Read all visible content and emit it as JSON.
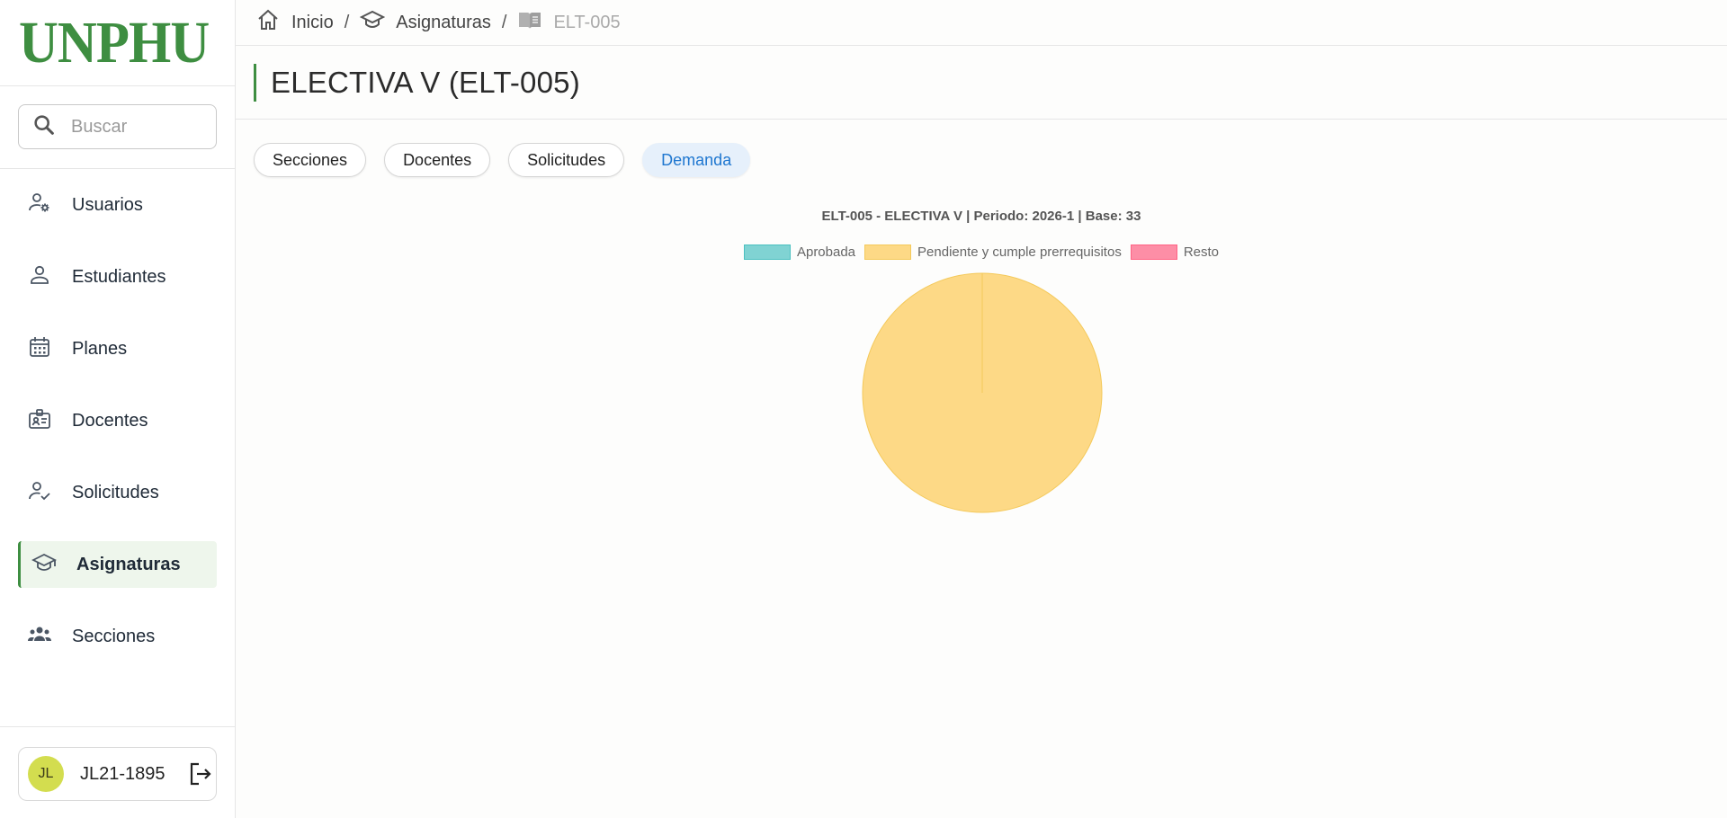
{
  "app": {
    "logo_text": "UNPHU"
  },
  "search": {
    "placeholder": "Buscar"
  },
  "sidebar": {
    "items": [
      {
        "label": "Usuarios",
        "icon": "user-gear-icon"
      },
      {
        "label": "Estudiantes",
        "icon": "user-icon"
      },
      {
        "label": "Planes",
        "icon": "calendar-icon"
      },
      {
        "label": "Docentes",
        "icon": "id-badge-icon"
      },
      {
        "label": "Solicitudes",
        "icon": "user-check-icon"
      },
      {
        "label": "Asignaturas",
        "icon": "graduation-cap-icon",
        "active": true
      },
      {
        "label": "Secciones",
        "icon": "group-icon"
      }
    ]
  },
  "user": {
    "initials": "JL",
    "name": "JL21-1895"
  },
  "breadcrumb": {
    "home": "Inicio",
    "section": "Asignaturas",
    "current": "ELT-005"
  },
  "page": {
    "title": "ELECTIVA V (ELT-005)"
  },
  "tabs": [
    {
      "label": "Secciones",
      "active": false
    },
    {
      "label": "Docentes",
      "active": false
    },
    {
      "label": "Solicitudes",
      "active": false
    },
    {
      "label": "Demanda",
      "active": true
    }
  ],
  "colors": {
    "accent": "#3e8e41",
    "tab_active_text": "#1f77d0"
  },
  "chart_data": {
    "type": "pie",
    "title": "ELT-005 - ELECTIVA V | Periodo: 2026-1 | Base: 33",
    "labels": [
      "Aprobada",
      "Pendiente y cumple prerrequisitos",
      "Resto"
    ],
    "values": [
      0,
      33,
      0
    ],
    "colors": [
      "#80d3d3",
      "#fdd986",
      "#fd8ea6"
    ],
    "border_colors": [
      "#4bc0c0",
      "#f4c95a",
      "#ff6384"
    ],
    "legend_position": "top"
  }
}
